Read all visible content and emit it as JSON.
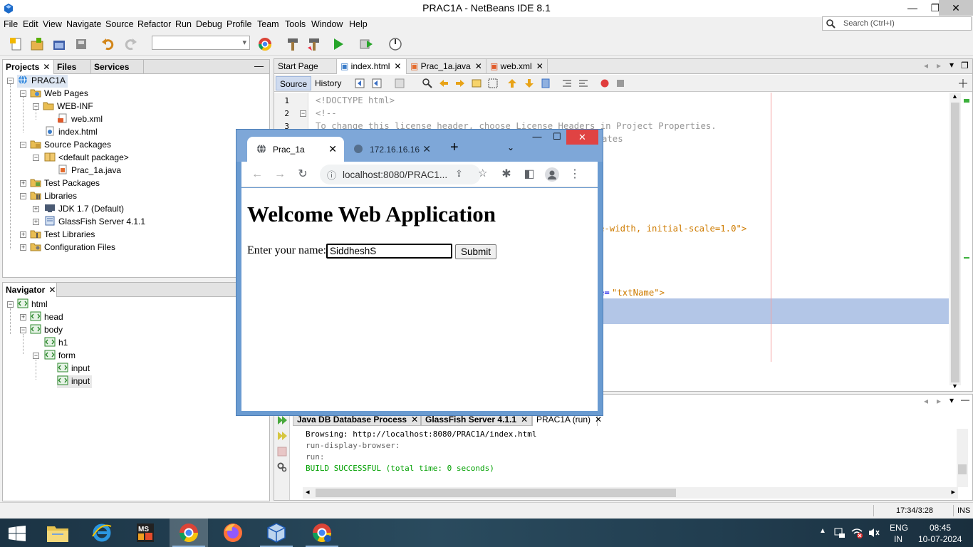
{
  "window": {
    "title": "PRAC1A - NetBeans IDE 8.1",
    "minimize": "—",
    "maximize": "❐",
    "close": "✕"
  },
  "menu": [
    "File",
    "Edit",
    "View",
    "Navigate",
    "Source",
    "Refactor",
    "Run",
    "Debug",
    "Profile",
    "Team",
    "Tools",
    "Window",
    "Help"
  ],
  "search": {
    "placeholder": "Search (Ctrl+I)"
  },
  "projects_panel": {
    "tabs": [
      "Projects",
      "Files",
      "Services"
    ],
    "tree": [
      {
        "label": "PRAC1A",
        "icon": "globe-project-icon",
        "selected": true
      },
      {
        "label": "Web Pages",
        "icon": "folder-icon"
      },
      {
        "label": "WEB-INF",
        "icon": "folder-icon"
      },
      {
        "label": "web.xml",
        "icon": "xml-file-icon"
      },
      {
        "label": "index.html",
        "icon": "html-file-icon"
      },
      {
        "label": "Source Packages",
        "icon": "package-folder-icon"
      },
      {
        "label": "<default package>",
        "icon": "package-icon"
      },
      {
        "label": "Prac_1a.java",
        "icon": "java-file-icon"
      },
      {
        "label": "Test Packages",
        "icon": "package-folder-icon"
      },
      {
        "label": "Libraries",
        "icon": "library-folder-icon"
      },
      {
        "label": "JDK 1.7 (Default)",
        "icon": "jdk-icon"
      },
      {
        "label": "GlassFish Server 4.1.1",
        "icon": "server-library-icon"
      },
      {
        "label": "Test Libraries",
        "icon": "library-folder-icon"
      },
      {
        "label": "Configuration Files",
        "icon": "config-folder-icon"
      }
    ]
  },
  "navigator": {
    "title": "Navigator",
    "tree": [
      "html",
      "head",
      "body",
      "h1",
      "form",
      "input",
      "input"
    ]
  },
  "editor": {
    "tabs": [
      "Start Page",
      "index.html",
      "Prac_1a.java",
      "web.xml"
    ],
    "source_label": "Source",
    "history_label": "History",
    "line_numbers": [
      "1",
      "2",
      "3"
    ],
    "code": {
      "line1": "<!DOCTYPE html>",
      "line2": "<!--",
      "line3": "To change this license header, choose License Headers in Project Properties.",
      "line4_tail": "ates",
      "meta_tail": "e-width, initial-scale=1.0\">",
      "input_tail_attr": "e=",
      "input_tail_val": "\"txtName\">"
    }
  },
  "output": {
    "tabs": [
      "Java DB Database Process",
      "GlassFish Server 4.1.1",
      "PRAC1A (run)"
    ],
    "lines": [
      "Browsing: http://localhost:8080/PRAC1A/index.html",
      "run-display-browser:",
      "run:",
      "BUILD SUCCESSFUL (total time: 0 seconds)"
    ]
  },
  "status": {
    "position": "17:34/3:28",
    "mode": "INS"
  },
  "browser": {
    "tabs": [
      {
        "title": "Prac_1a",
        "close": "✕"
      },
      {
        "title": "172.16.16.16",
        "close": "✕"
      }
    ],
    "new_tab": "+",
    "url": "localhost:8080/PRAC1...",
    "heading": "Welcome Web Application",
    "label": "Enter your name:",
    "input_value": "SiddheshS",
    "submit_label": "Submit"
  },
  "taskbar": {
    "lang": "ENG",
    "region": "IN",
    "time": "08:45",
    "date": "10-07-2024"
  },
  "colors": {
    "accent": "#1d5ab4",
    "browser_frame": "#6a9bd1",
    "close_red": "#e04343",
    "build_green": "#00a000"
  }
}
